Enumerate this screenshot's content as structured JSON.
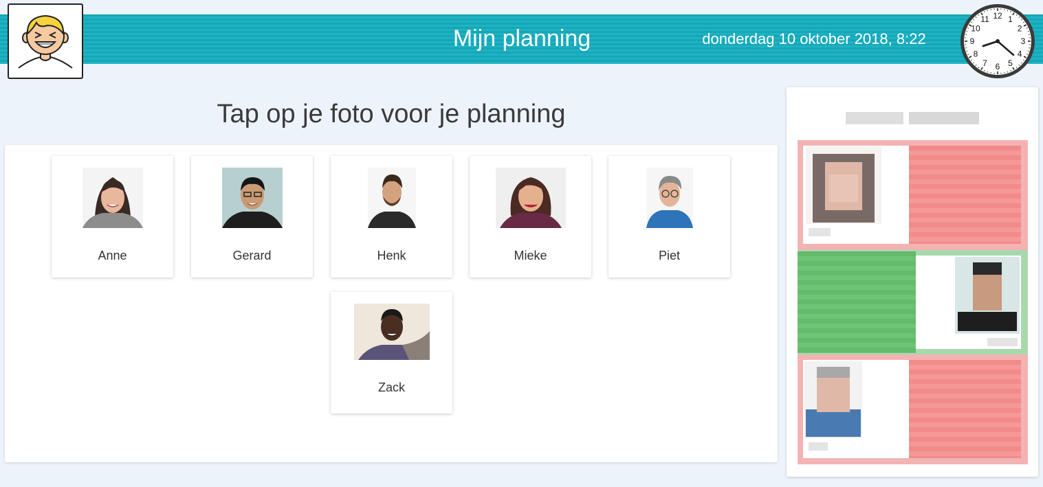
{
  "header": {
    "title": "Mijn planning",
    "datetime": "donderdag 10 oktober 2018, 8:22"
  },
  "avatar": {
    "icon": "smiling-boy-pictogram"
  },
  "clock": {
    "numbers": [
      "12",
      "1",
      "2",
      "3",
      "4",
      "5",
      "6",
      "7",
      "8",
      "9",
      "10",
      "11"
    ],
    "time": "8:22"
  },
  "main": {
    "prompt": "Tap op je foto voor je planning",
    "people": [
      {
        "name": "Anne"
      },
      {
        "name": "Gerard"
      },
      {
        "name": "Henk"
      },
      {
        "name": "Mieke"
      },
      {
        "name": "Piet"
      },
      {
        "name": "Zack"
      }
    ]
  },
  "status_panel": {
    "rows": [
      {
        "status": "red",
        "color": "#f28a8a"
      },
      {
        "status": "green",
        "color": "#63bb6b"
      },
      {
        "status": "red",
        "color": "#f28a8a"
      }
    ]
  },
  "colors": {
    "header": "#14a7b7",
    "background": "#edf3fa",
    "status_red": "#f28a8a",
    "status_green": "#63bb6b"
  }
}
